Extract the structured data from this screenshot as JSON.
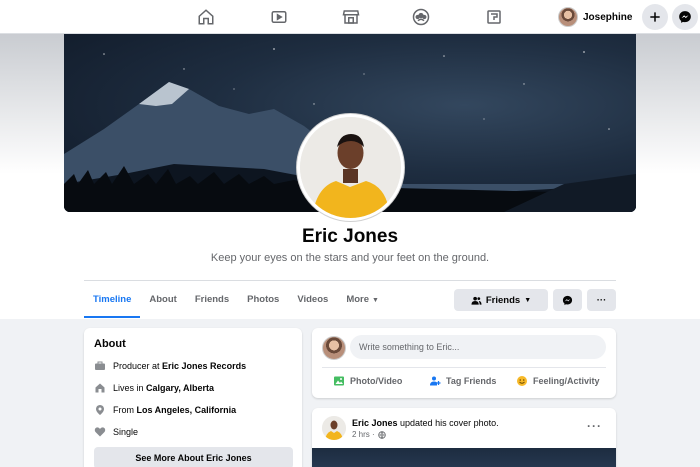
{
  "topbar": {
    "nav": [
      {
        "name": "home-icon"
      },
      {
        "name": "watch-icon"
      },
      {
        "name": "marketplace-icon"
      },
      {
        "name": "groups-icon"
      },
      {
        "name": "gaming-icon"
      }
    ],
    "user_name": "Josephine",
    "create_icon": "plus-icon",
    "messenger_icon": "messenger-icon"
  },
  "profile": {
    "name": "Eric Jones",
    "bio": "Keep your eyes on the stars and your feet on the ground."
  },
  "tabs": [
    {
      "label": "Timeline",
      "active": true
    },
    {
      "label": "About"
    },
    {
      "label": "Friends"
    },
    {
      "label": "Photos"
    },
    {
      "label": "Videos"
    },
    {
      "label": "More"
    }
  ],
  "actions": {
    "friends_label": "Friends",
    "messenger_icon": "messenger-icon",
    "more_label": "···"
  },
  "about": {
    "title": "About",
    "rows": [
      {
        "icon": "briefcase-icon",
        "prefix": "Producer at ",
        "value": "Eric Jones Records"
      },
      {
        "icon": "home-icon",
        "prefix": "Lives in ",
        "value": "Calgary, Alberta"
      },
      {
        "icon": "location-pin-icon",
        "prefix": "From ",
        "value": "Los Angeles, California"
      },
      {
        "icon": "heart-icon",
        "prefix": "",
        "value": "Single"
      }
    ],
    "see_more": "See More About Eric Jones"
  },
  "composer": {
    "placeholder": "Write something to Eric...",
    "actions": [
      "Photo/Video",
      "Tag Friends",
      "Feeling/Activity"
    ]
  },
  "post": {
    "author": "Eric Jones",
    "action_text": " updated his cover photo.",
    "time": "2 hrs ·",
    "more_label": "···"
  },
  "colors": {
    "accent": "#1877f2",
    "background": "#f0f2f5",
    "button_bg": "#e4e6eb",
    "secondary_text": "#65676b"
  }
}
